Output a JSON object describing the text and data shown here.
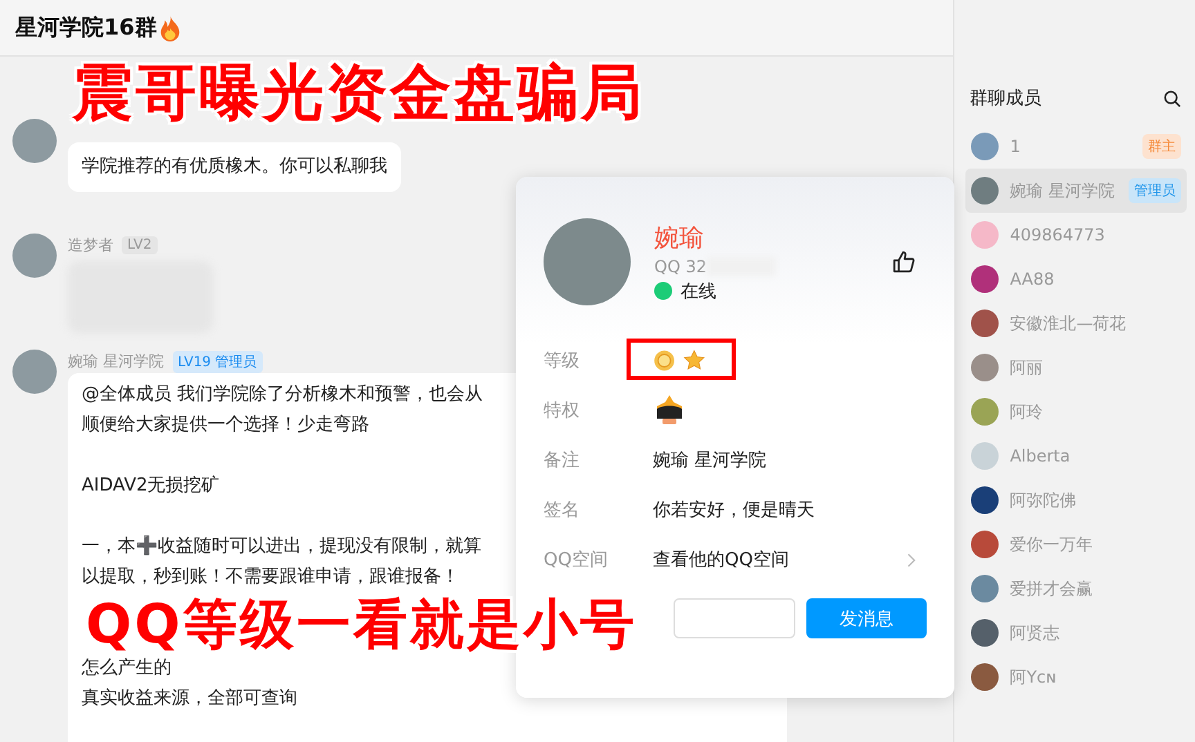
{
  "window": {
    "title": "星河学院16群"
  },
  "messages": [
    {
      "kind": "text",
      "paragraphs": [
        [
          "学院推荐的有优质橡木。你可以私聊我"
        ]
      ]
    },
    {
      "kind": "blurred",
      "sender": "造梦者",
      "badge": {
        "text": "LV2",
        "kind": "level"
      }
    },
    {
      "kind": "text",
      "sender": "婉瑜 星河学院",
      "badge": {
        "text": "LV19 管理员",
        "kind": "admin"
      },
      "paragraphs": [
        [
          "@全体成员 我们学院除了分析橡木和预警，也会从",
          "顺便给大家提供一个选择！少走弯路"
        ],
        [
          "AIDAV2无损挖矿"
        ],
        [
          "一，本➕收益随时可以进出，提现没有限制，就算",
          "以提取，秒到账！不需要跟谁申请，跟谁报备！"
        ],
        [
          "怎么产生的",
          "真实收益来源，全部可查询"
        ]
      ]
    }
  ],
  "profile": {
    "name": "婉瑜",
    "qq": "QQ 32",
    "status": "在线",
    "online": true,
    "rows": [
      {
        "label": "等级",
        "kind": "level"
      },
      {
        "label": "特权",
        "kind": "privilege"
      },
      {
        "label": "备注",
        "kind": "text",
        "value": "婉瑜 星河学院"
      },
      {
        "label": "签名",
        "kind": "text",
        "value": "你若安好，便是晴天"
      },
      {
        "label": "QQ空间",
        "kind": "link",
        "value": "查看他的QQ空间"
      }
    ],
    "buttons": [
      {
        "kind": "outline"
      },
      {
        "label": "发消息",
        "kind": "primary"
      }
    ]
  },
  "members_panel": {
    "title": "群聊成员",
    "members": [
      {
        "name": "1",
        "role": {
          "text": "群主",
          "kind": "owner"
        },
        "selected": false,
        "color": "#7a9ab8"
      },
      {
        "name": "婉瑜 星河学院",
        "role": {
          "text": "管理员",
          "kind": "admin"
        },
        "selected": true,
        "color": "#6f7d80"
      },
      {
        "name": "409864773",
        "selected": false,
        "color": "#f5b8c8"
      },
      {
        "name": "AA88",
        "selected": false,
        "color": "#b0307a"
      },
      {
        "name": "安徽淮北—荷花",
        "selected": false,
        "color": "#a0524a"
      },
      {
        "name": "阿丽",
        "selected": false,
        "color": "#9a8f8a"
      },
      {
        "name": "阿玲",
        "selected": false,
        "color": "#9aa455"
      },
      {
        "name": "Alberta",
        "selected": false,
        "color": "#c9d3d8"
      },
      {
        "name": "阿弥陀佛",
        "selected": false,
        "color": "#1a3f78"
      },
      {
        "name": "爱你一万年",
        "selected": false,
        "color": "#b84a3a"
      },
      {
        "name": "爱拼才会赢",
        "selected": false,
        "color": "#6b8aa0"
      },
      {
        "name": "阿贤志",
        "selected": false,
        "color": "#55606a"
      },
      {
        "name": "阿Yᴄɴ",
        "selected": false,
        "color": "#8a5a40"
      }
    ]
  },
  "annotations": [
    {
      "text": "震哥曝光资金盘骗局",
      "kind": "top"
    },
    {
      "text": "QQ等级一看就是小号",
      "kind": "bottom"
    }
  ]
}
